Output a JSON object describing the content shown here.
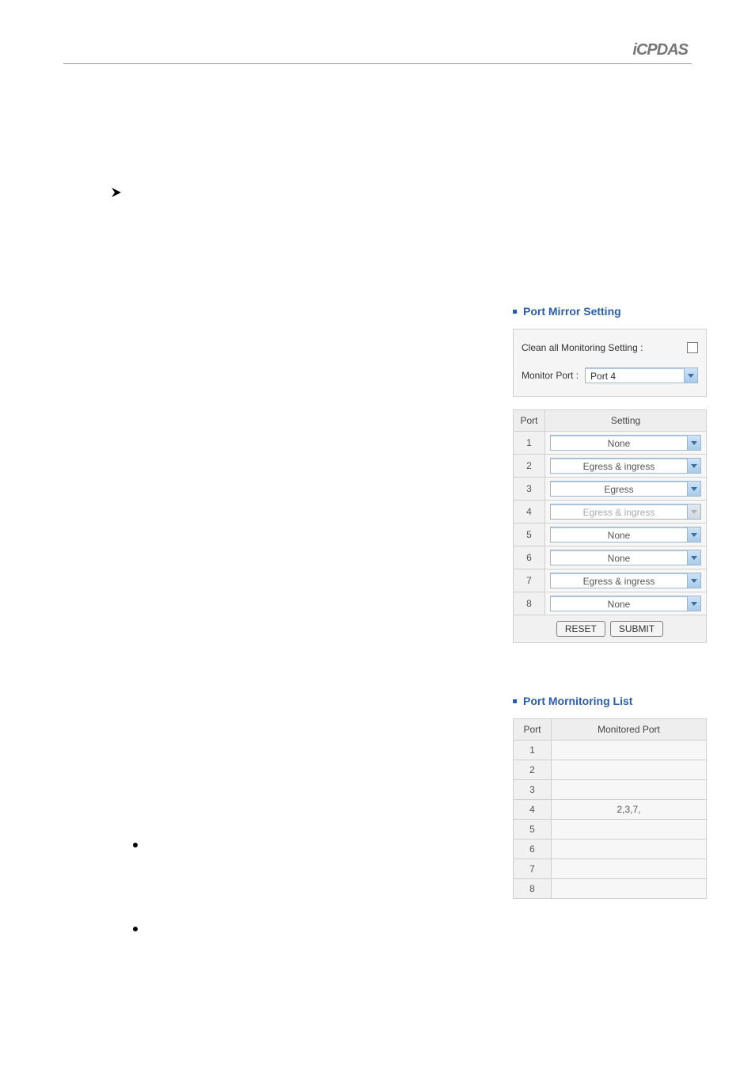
{
  "logo": {
    "text": "iCPDAS"
  },
  "mirror_section": {
    "title": "Port Mirror Setting",
    "clean_label": "Clean all Monitoring Setting :",
    "monitor_port_label": "Monitor Port :",
    "monitor_port_value": "Port 4",
    "table_headers": {
      "port": "Port",
      "setting": "Setting"
    },
    "rows": [
      {
        "port": "1",
        "setting": "None",
        "disabled": false
      },
      {
        "port": "2",
        "setting": "Egress & ingress",
        "disabled": false
      },
      {
        "port": "3",
        "setting": "Egress",
        "disabled": false
      },
      {
        "port": "4",
        "setting": "Egress & ingress",
        "disabled": true
      },
      {
        "port": "5",
        "setting": "None",
        "disabled": false
      },
      {
        "port": "6",
        "setting": "None",
        "disabled": false
      },
      {
        "port": "7",
        "setting": "Egress & ingress",
        "disabled": false
      },
      {
        "port": "8",
        "setting": "None",
        "disabled": false
      }
    ],
    "buttons": {
      "reset": "RESET",
      "submit": "SUBMIT"
    }
  },
  "monitoring_section": {
    "title": "Port Mornitoring List",
    "table_headers": {
      "port": "Port",
      "monitored": "Monitored Port"
    },
    "rows": [
      {
        "port": "1",
        "monitored": ""
      },
      {
        "port": "2",
        "monitored": ""
      },
      {
        "port": "3",
        "monitored": ""
      },
      {
        "port": "4",
        "monitored": "2,3,7,"
      },
      {
        "port": "5",
        "monitored": ""
      },
      {
        "port": "6",
        "monitored": ""
      },
      {
        "port": "7",
        "monitored": ""
      },
      {
        "port": "8",
        "monitored": ""
      }
    ]
  }
}
